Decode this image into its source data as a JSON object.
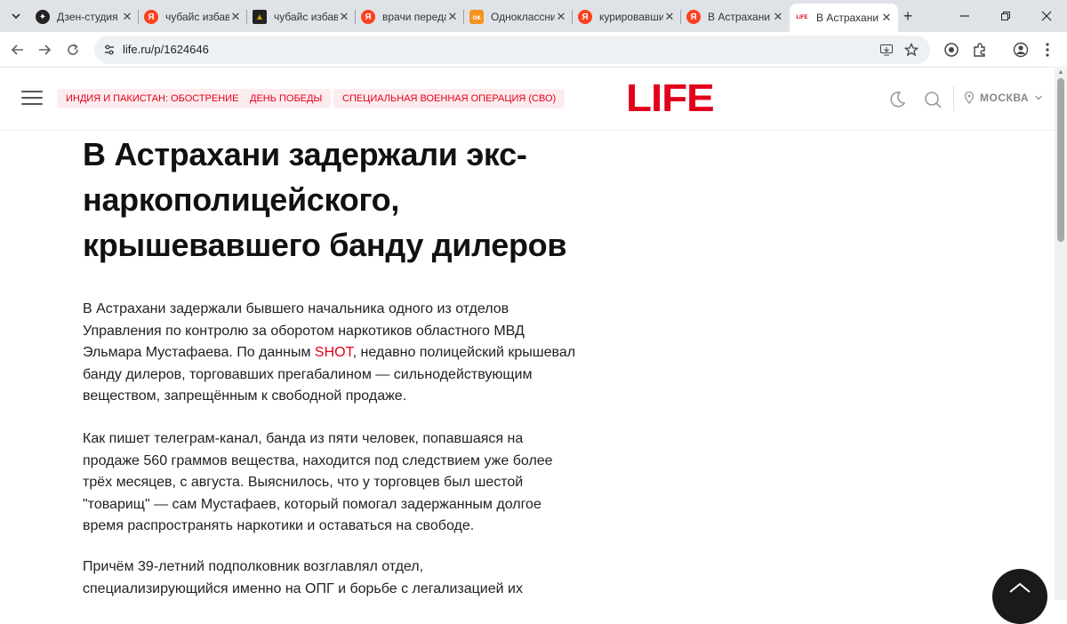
{
  "browser": {
    "tabs": [
      {
        "title": "Дзен-студия",
        "favicon": "dzen",
        "color": "#222222",
        "glyph": "✦"
      },
      {
        "title": "чубайс избавился",
        "favicon": "yandex",
        "color": "#fc3f1d",
        "glyph": "Я"
      },
      {
        "title": "чубайс избавился",
        "favicon": "image-thumb",
        "color": "#c8a000",
        "glyph": "▲"
      },
      {
        "title": "врачи передали",
        "favicon": "yandex",
        "color": "#fc3f1d",
        "glyph": "Я"
      },
      {
        "title": "Одноклассники",
        "favicon": "ok",
        "color": "#f7931e",
        "glyph": "ок"
      },
      {
        "title": "курировавший",
        "favicon": "yandex",
        "color": "#fc3f1d",
        "glyph": "Я"
      },
      {
        "title": "В Астрахани",
        "favicon": "yandex",
        "color": "#fc3f1d",
        "glyph": "Я"
      },
      {
        "title": "В Астрахани",
        "favicon": "life",
        "color": "#e2001a",
        "glyph": "LIFE",
        "active": true
      }
    ],
    "url": "life.ru/p/1624646"
  },
  "site": {
    "logo": "LIFE",
    "nav_pills": [
      "ИНДИЯ И ПАКИСТАН: ОБОСТРЕНИЕ",
      "ДЕНЬ ПОБЕДЫ",
      "СПЕЦИАЛЬНАЯ ВОЕННАЯ ОПЕРАЦИЯ (СВО)"
    ],
    "city": "МОСКВА",
    "accent": "#e2001a"
  },
  "article": {
    "headline_lines": [
      "В Астрахани задержали экс-",
      "наркополицейского,",
      "крышевавшего банду дилеров"
    ],
    "p1": {
      "lines": [
        "В Астрахани задержали бывшего начальника одного из отделов",
        "Управления по контролю за оборотом наркотиков областного МВД"
      ],
      "line3_before": "Эльмара Мустафаева. По данным ",
      "link": "SHOT",
      "line3_after": ", недавно полицейский крышевал",
      "lines_end": [
        "банду дилеров, торговавших прегабалином — сильнодействующим",
        "веществом, запрещённым к свободной продаже."
      ]
    },
    "p2_lines": [
      "Как пишет телеграм-канал, банда из пяти человек, попавшаяся на",
      "продаже 560 граммов вещества, находится под следствием уже более",
      "трёх месяцев, с августа. Выяснилось, что у торговцев был шестой",
      "\"товарищ\" — сам Мустафаев, который помогал задержанным долгое",
      "время распространять наркотики и оставаться на свободе."
    ],
    "p3_lines": [
      "Причём 39-летний подполковник возглавлял отдел,",
      "специализирующийся именно на ОПГ и борьбе с легализацией их"
    ]
  }
}
